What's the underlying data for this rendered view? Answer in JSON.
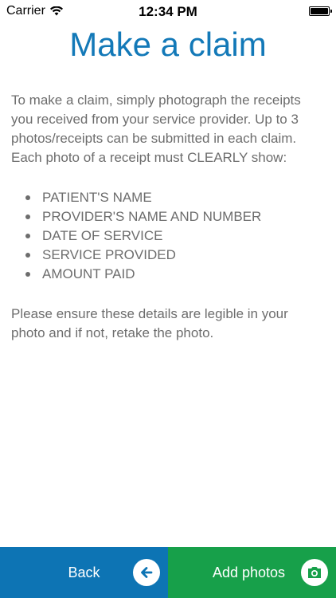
{
  "status_bar": {
    "carrier": "Carrier",
    "time": "12:34 PM",
    "wifi_icon": "wifi-icon",
    "battery_icon": "battery-icon"
  },
  "page": {
    "title": "Make a claim",
    "intro": "To make a claim, simply photograph the receipts you received from your service provider. Up to 3 photos/receipts can be submitted in each claim. Each photo of a receipt must CLEARLY show:",
    "requirements": [
      "PATIENT'S NAME",
      "PROVIDER'S NAME AND NUMBER",
      "DATE OF SERVICE",
      "SERVICE PROVIDED",
      "AMOUNT PAID"
    ],
    "outro": "Please ensure these details are legible in your photo and if not, retake the photo."
  },
  "buttons": {
    "back_label": "Back",
    "back_icon": "arrow-left-icon",
    "add_label": "Add photos",
    "add_icon": "camera-icon"
  },
  "colors": {
    "title": "#1379b8",
    "back_button": "#0d74b4",
    "add_button": "#17a04a",
    "body_text": "#6d6d6d"
  }
}
